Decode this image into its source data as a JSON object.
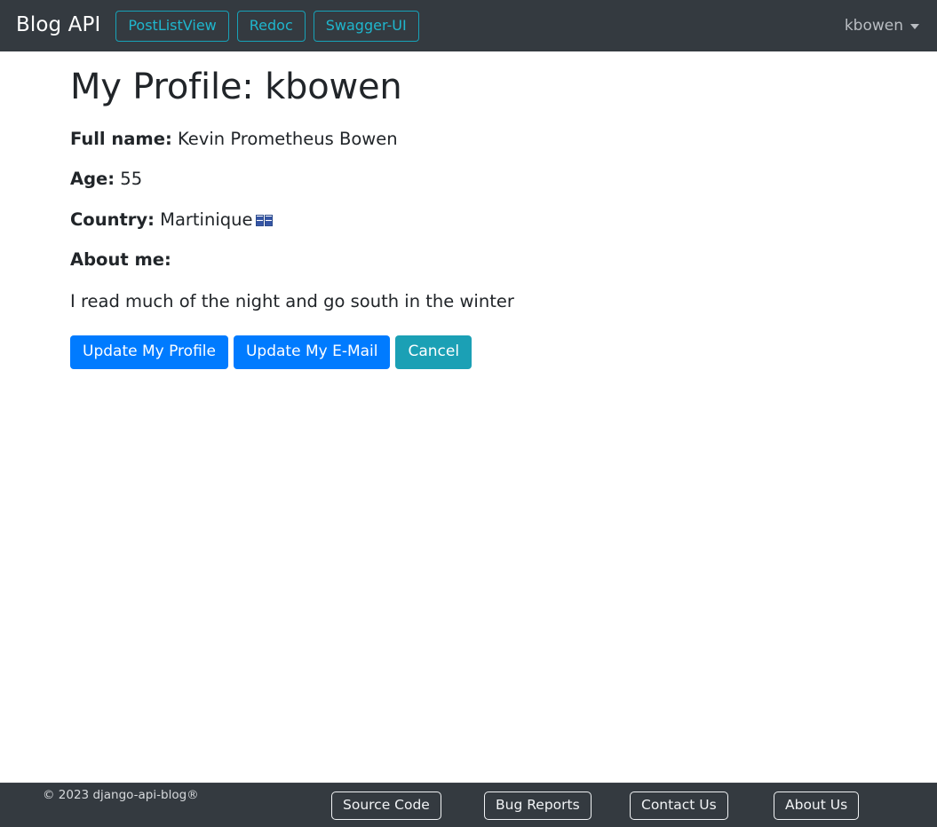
{
  "navbar": {
    "brand": "Blog API",
    "links": [
      {
        "label": "PostListView",
        "name": "nav-link-postlistview"
      },
      {
        "label": "Redoc",
        "name": "nav-link-redoc"
      },
      {
        "label": "Swagger-UI",
        "name": "nav-link-swagger-ui"
      }
    ],
    "user": {
      "username": "kbowen",
      "caret_icon": "chevron-down-icon"
    },
    "background_color": "#343a40",
    "link_color": "#17a2b8"
  },
  "main": {
    "title": "My Profile: kbowen",
    "fields": [
      {
        "label": "Full name:",
        "value": "Kevin Prometheus Bowen"
      },
      {
        "label": "Age:",
        "value": "55"
      },
      {
        "label": "Country:",
        "value": "Martinique",
        "flag_icon": "flag-icon-missing-glyph"
      },
      {
        "label": "About me:",
        "value": ""
      }
    ],
    "about_text": "I read much of the night and go south in the winter",
    "buttons": [
      {
        "label": "Update My Profile",
        "style": "primary",
        "color": "#007bff"
      },
      {
        "label": "Update My E-Mail",
        "style": "primary",
        "color": "#007bff"
      },
      {
        "label": "Cancel",
        "style": "info",
        "color": "#1ba0b5"
      }
    ]
  },
  "footer": {
    "copyright": "© 2023 django-api-blog®",
    "links": [
      {
        "label": "Source Code",
        "name": "footer-link-source-code"
      },
      {
        "label": "Bug Reports",
        "name": "footer-link-bug-reports"
      },
      {
        "label": "Contact Us",
        "name": "footer-link-contact-us"
      },
      {
        "label": "About Us",
        "name": "footer-link-about-us"
      }
    ],
    "background_color": "#343a40"
  }
}
